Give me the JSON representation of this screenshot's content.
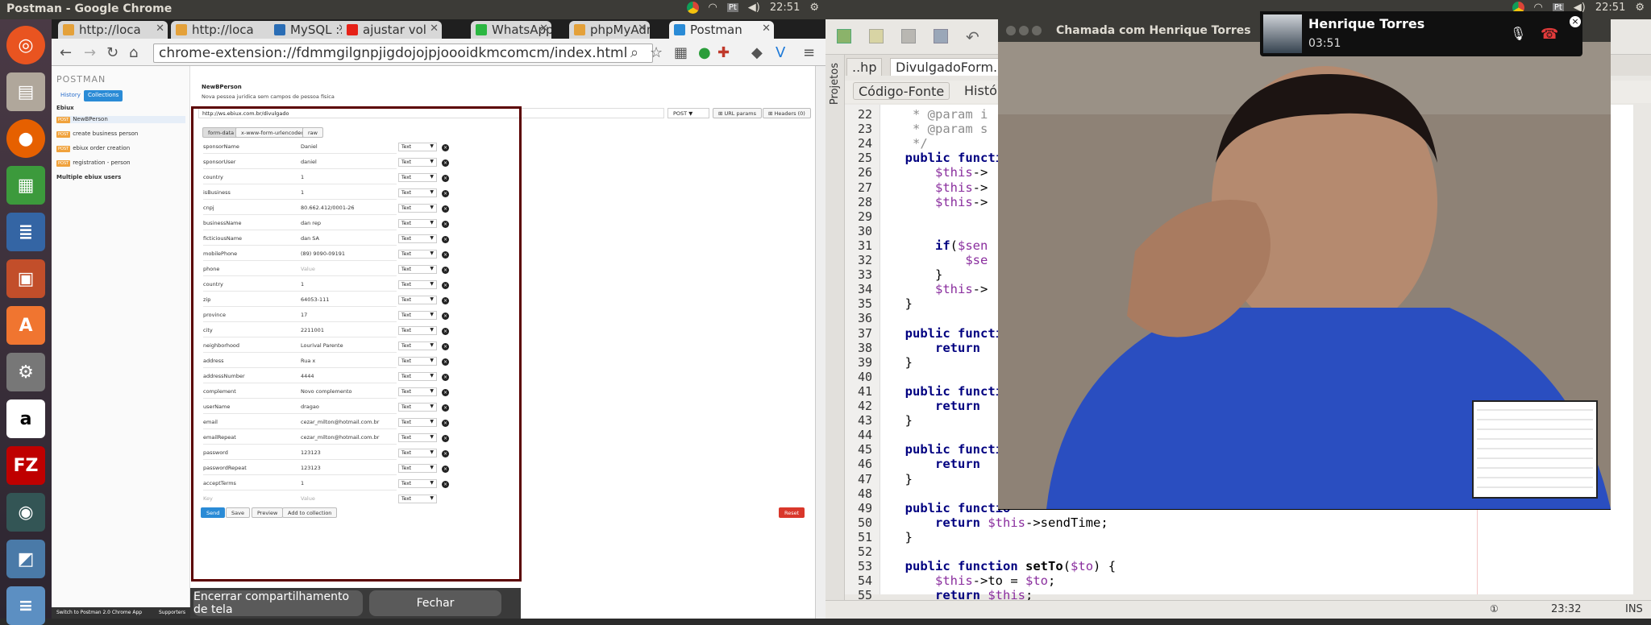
{
  "left_topbar": {
    "title": "Postman - Google Chrome",
    "time": "22:51"
  },
  "right_topbar": {
    "time": "22:51"
  },
  "browser": {
    "tabs": [
      {
        "label": "http://loca",
        "color": "#e4a13a"
      },
      {
        "label": "http://loca",
        "color": "#e4a13a"
      },
      {
        "label": "MySQL :: M",
        "color": "#2a6db5"
      },
      {
        "label": "ajustar vol",
        "color": "#e62117"
      },
      {
        "label": "WhatsApp",
        "color": "#2bb741"
      },
      {
        "label": "phpMyAdm",
        "color": "#e4a13a"
      },
      {
        "label": "Postman",
        "color": "#2a8bd6"
      }
    ],
    "url": "chrome-extension://fdmmgilgnpjigdojojpjoooidkmcomcm/index.html"
  },
  "postman": {
    "logo": "POSTMAN",
    "sidebar_tabs": {
      "history": "History",
      "collections": "Collections"
    },
    "collection_name": "Ebiux",
    "requests": [
      {
        "method": "POST",
        "name": "NewBPerson"
      },
      {
        "method": "POST",
        "name": "create business person"
      },
      {
        "method": "POST",
        "name": "ebiux order creation"
      },
      {
        "method": "POST",
        "name": "registration - person"
      }
    ],
    "collection2": "Multiple ebiux users",
    "status_bar": {
      "switch": "Switch to Postman 2.0 Chrome App",
      "supporters": "Supporters"
    },
    "request_title": "NewBPerson",
    "request_desc": "Nova pessoa juridica sem campos de pessoa fisica",
    "request_url": "http://ws.ebiux.com.br/divulgado",
    "method": "POST",
    "url_params": "URL params",
    "headers": "Headers (0)",
    "body_tabs": [
      "form-data",
      "x-www-form-urlencoded",
      "raw"
    ],
    "rows": [
      {
        "key": "sponsorName",
        "value": "Daniel",
        "type": "Text"
      },
      {
        "key": "sponsorUser",
        "value": "daniel",
        "type": "Text"
      },
      {
        "key": "country",
        "value": "1",
        "type": "Text"
      },
      {
        "key": "isBusiness",
        "value": "1",
        "type": "Text"
      },
      {
        "key": "cnpj",
        "value": "80.662.412/0001-26",
        "type": "Text"
      },
      {
        "key": "businessName",
        "value": "dan rep",
        "type": "Text"
      },
      {
        "key": "ficticiousName",
        "value": "dan SA",
        "type": "Text"
      },
      {
        "key": "mobilePhone",
        "value": "(89) 9090-09191",
        "type": "Text"
      },
      {
        "key": "phone",
        "value": "Value",
        "type": "Text",
        "placeholder": true
      },
      {
        "key": "country",
        "value": "1",
        "type": "Text"
      },
      {
        "key": "zip",
        "value": "64053-111",
        "type": "Text"
      },
      {
        "key": "province",
        "value": "17",
        "type": "Text"
      },
      {
        "key": "city",
        "value": "2211001",
        "type": "Text"
      },
      {
        "key": "neighborhood",
        "value": "Lourival Parente",
        "type": "Text"
      },
      {
        "key": "address",
        "value": "Rua x",
        "type": "Text"
      },
      {
        "key": "addressNumber",
        "value": "4444",
        "type": "Text"
      },
      {
        "key": "complement",
        "value": "Novo complemento",
        "type": "Text"
      },
      {
        "key": "userName",
        "value": "dragao",
        "type": "Text"
      },
      {
        "key": "email",
        "value": "cezar_milton@hotmail.com.br",
        "type": "Text"
      },
      {
        "key": "emailRepeat",
        "value": "cezar_milton@hotmail.com.br",
        "type": "Text"
      },
      {
        "key": "password",
        "value": "123123",
        "type": "Text"
      },
      {
        "key": "passwordRepeat",
        "value": "123123",
        "type": "Text"
      },
      {
        "key": "acceptTerms",
        "value": "1",
        "type": "Text"
      }
    ],
    "new_row": {
      "key_placeholder": "Key",
      "value_placeholder": "Value",
      "type": "Text"
    },
    "buttons": {
      "send": "Send",
      "save": "Save",
      "preview": "Preview",
      "add": "Add to collection",
      "reset": "Reset"
    }
  },
  "screen_share": {
    "stop": "Encerrar compartilhamento de tela",
    "close": "Fechar"
  },
  "ide": {
    "tabs": [
      "..hp",
      "DivulgadoForm.php"
    ],
    "source_tab": "Código-Fonte",
    "history_tab": "Históri",
    "projects_label": "Projetos",
    "status_time": "23:32",
    "status_mode": "INS",
    "lines": [
      {
        "n": "22",
        "html": "<span class='cm'>   * @param i</span>"
      },
      {
        "n": "23",
        "html": "<span class='cm'>   * @param s</span>"
      },
      {
        "n": "24",
        "html": "<span class='cm'>   */</span>"
      },
      {
        "n": "25",
        "html": "  <span class='kw'>public</span> <span class='kw'>functio</span>"
      },
      {
        "n": "26",
        "html": "      <span class='vr'>$this</span>-&gt;"
      },
      {
        "n": "27",
        "html": "      <span class='vr'>$this</span>-&gt;"
      },
      {
        "n": "28",
        "html": "      <span class='vr'>$this</span>-&gt;"
      },
      {
        "n": "29",
        "html": ""
      },
      {
        "n": "30",
        "html": ""
      },
      {
        "n": "31",
        "html": "      <span class='kw'>if</span>(<span class='vr'>$sen</span>"
      },
      {
        "n": "32",
        "html": "          <span class='vr'>$se</span>"
      },
      {
        "n": "33",
        "html": "      }"
      },
      {
        "n": "34",
        "html": "      <span class='vr'>$this</span>-&gt;"
      },
      {
        "n": "35",
        "html": "  }"
      },
      {
        "n": "36",
        "html": ""
      },
      {
        "n": "37",
        "html": "  <span class='kw'>public</span> <span class='kw'>functio</span>"
      },
      {
        "n": "38",
        "html": "      <span class='kw'>return</span>"
      },
      {
        "n": "39",
        "html": "  }"
      },
      {
        "n": "40",
        "html": ""
      },
      {
        "n": "41",
        "html": "  <span class='kw'>public</span> <span class='kw'>functio</span>"
      },
      {
        "n": "42",
        "html": "      <span class='kw'>return</span>"
      },
      {
        "n": "43",
        "html": "  }"
      },
      {
        "n": "44",
        "html": ""
      },
      {
        "n": "45",
        "html": "  <span class='kw'>public</span> <span class='kw'>functio</span>"
      },
      {
        "n": "46",
        "html": "      <span class='kw'>return</span>"
      },
      {
        "n": "47",
        "html": "  }"
      },
      {
        "n": "48",
        "html": ""
      },
      {
        "n": "49",
        "html": "  <span class='kw'>public</span> <span class='kw'>functio</span>"
      },
      {
        "n": "50",
        "html": "      <span class='kw'>return</span> <span class='vr'>$this</span>-&gt;sendTime;"
      },
      {
        "n": "51",
        "html": "  }"
      },
      {
        "n": "52",
        "html": ""
      },
      {
        "n": "53",
        "html": "  <span class='kw'>public</span> <span class='kw'>function</span> <b>setTo</b>(<span class='vr'>$to</span>) {"
      },
      {
        "n": "54",
        "html": "      <span class='vr'>$this</span>-&gt;to = <span class='vr'>$to</span>;"
      },
      {
        "n": "55",
        "html": "      <span class='kw'>return</span> <span class='vr'>$this</span>;"
      }
    ]
  },
  "call": {
    "window_title": "Chamada com Henrique Torres",
    "caller": "Henrique Torres",
    "duration": "03:51"
  }
}
